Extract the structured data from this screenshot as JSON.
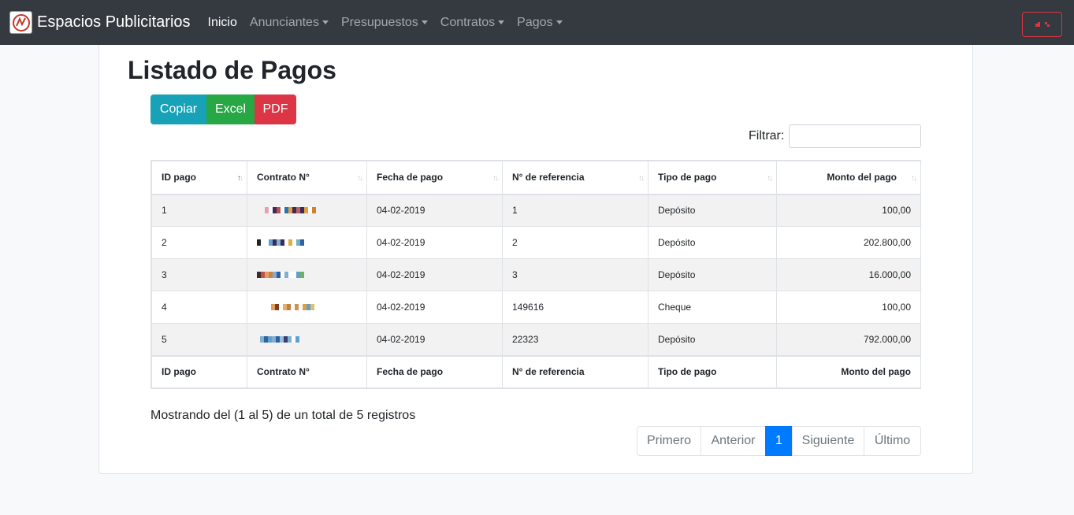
{
  "navbar": {
    "brand": "Espacios Publicitarios",
    "items": [
      {
        "label": "Inicio",
        "active": true,
        "dropdown": false
      },
      {
        "label": "Anunciantes",
        "active": false,
        "dropdown": true
      },
      {
        "label": "Presupuestos",
        "active": false,
        "dropdown": true
      },
      {
        "label": "Contratos",
        "active": false,
        "dropdown": true
      },
      {
        "label": "Pagos",
        "active": false,
        "dropdown": true
      }
    ]
  },
  "page": {
    "title": "Listado de Pagos"
  },
  "export_buttons": {
    "copy": "Copiar",
    "excel": "Excel",
    "pdf": "PDF"
  },
  "filter": {
    "label": "Filtrar:",
    "value": ""
  },
  "table": {
    "headers": [
      "ID pago",
      "Contrato N°",
      "Fecha de pago",
      "N° de referencia",
      "Tipo de pago",
      "Monto del pago"
    ],
    "rows": [
      {
        "id": "1",
        "contrato": "",
        "fecha": "04-02-2019",
        "referencia": "1",
        "tipo": "Depósito",
        "monto": "100,00"
      },
      {
        "id": "2",
        "contrato": "",
        "fecha": "04-02-2019",
        "referencia": "2",
        "tipo": "Depósito",
        "monto": "202.800,00"
      },
      {
        "id": "3",
        "contrato": "",
        "fecha": "04-02-2019",
        "referencia": "3",
        "tipo": "Depósito",
        "monto": "16.000,00"
      },
      {
        "id": "4",
        "contrato": "",
        "fecha": "04-02-2019",
        "referencia": "149616",
        "tipo": "Cheque",
        "monto": "100,00"
      },
      {
        "id": "5",
        "contrato": "",
        "fecha": "04-02-2019",
        "referencia": "22323",
        "tipo": "Depósito",
        "monto": "792.000,00"
      }
    ]
  },
  "info": "Mostrando del (1 al 5) de un total de 5 registros",
  "pagination": {
    "first": "Primero",
    "prev": "Anterior",
    "current": "1",
    "next": "Siguiente",
    "last": "Último"
  },
  "colors": {
    "navbar": "#343a40",
    "copy": "#17a2b8",
    "excel": "#28a745",
    "pdf": "#dc3545",
    "page_active": "#007bff"
  }
}
